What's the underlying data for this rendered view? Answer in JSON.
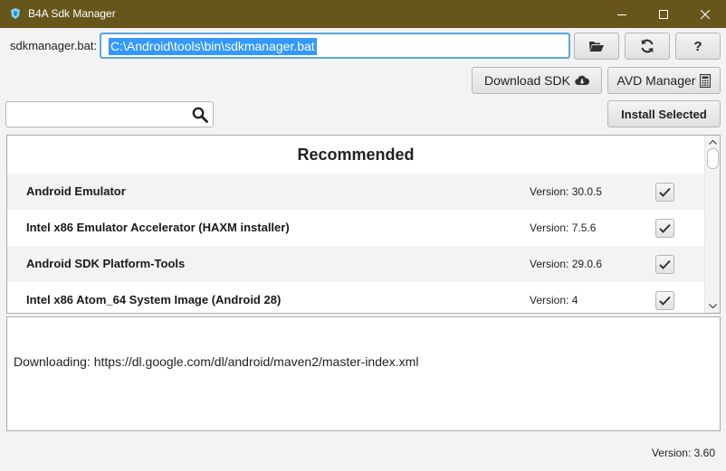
{
  "window": {
    "title": "B4A Sdk Manager",
    "titlebar_color": "#66561c"
  },
  "toolbar": {
    "sdk_label": "sdkmanager.bat:",
    "sdk_path": "C:\\Android\\tools\\bin\\sdkmanager.bat",
    "download_sdk_label": "Download SDK",
    "avd_manager_label": "AVD Manager",
    "install_selected_label": "Install Selected",
    "help_label": "?"
  },
  "search": {
    "value": ""
  },
  "list": {
    "section_title": "Recommended",
    "items": [
      {
        "name": "Android Emulator",
        "version": "Version: 30.0.5",
        "checked": true
      },
      {
        "name": "Intel x86 Emulator Accelerator (HAXM installer)",
        "version": "Version: 7.5.6",
        "checked": true
      },
      {
        "name": "Android SDK Platform-Tools",
        "version": "Version: 29.0.6",
        "checked": true
      },
      {
        "name": "Intel x86 Atom_64 System Image (Android 28)",
        "version": "Version: 4",
        "checked": true
      }
    ]
  },
  "log": {
    "text": "Downloading: https://dl.google.com/dl/android/maven2/master-index.xml"
  },
  "footer": {
    "version": "Version: 3.60"
  },
  "colors": {
    "accent": "#3399ff",
    "focus_border": "#5aa7dc"
  }
}
